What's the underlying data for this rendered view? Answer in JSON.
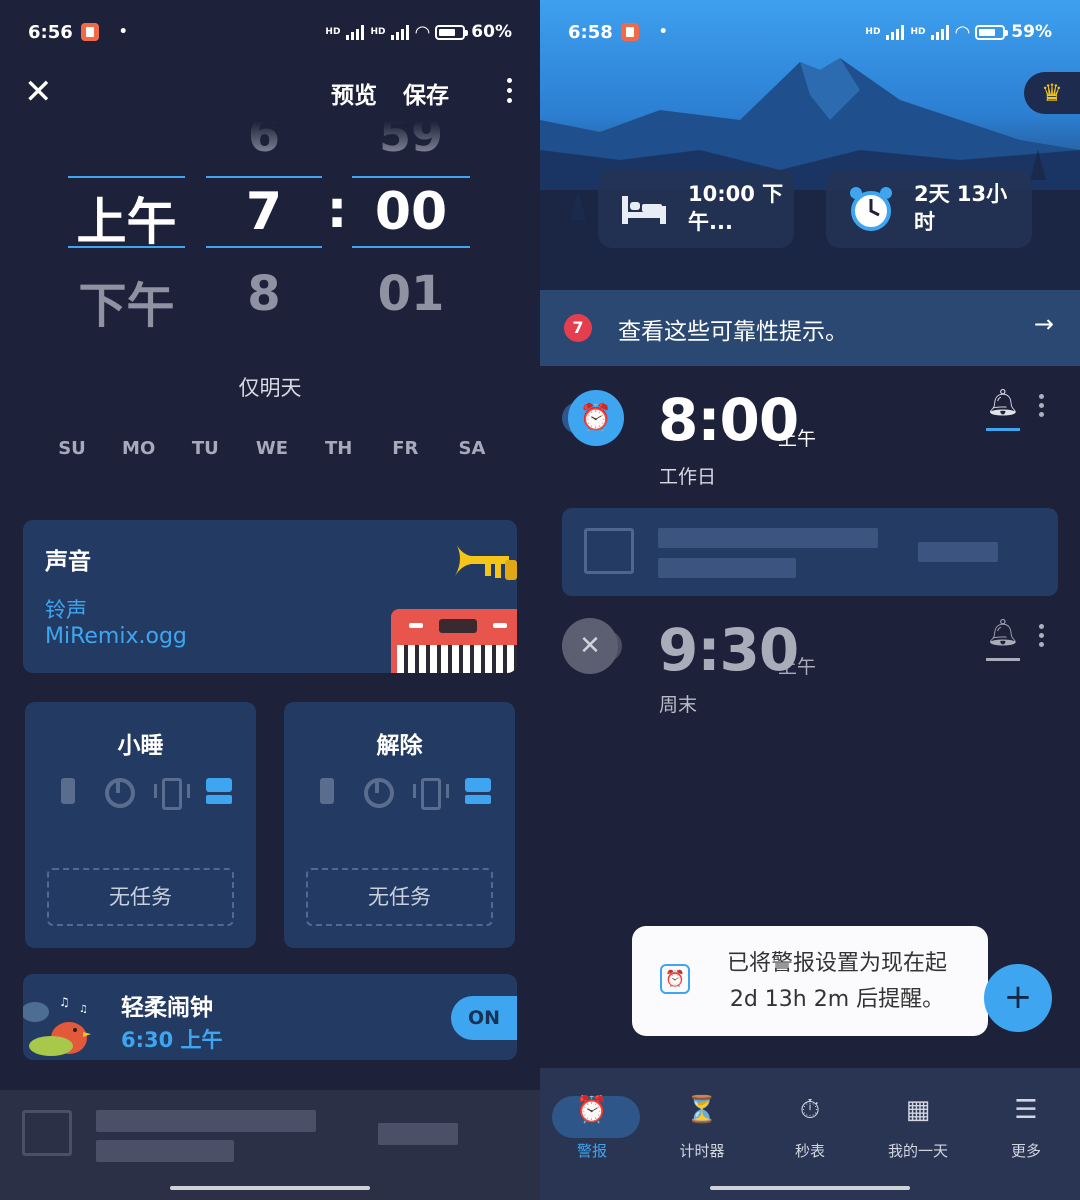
{
  "left": {
    "status": {
      "time": "6:56",
      "dot": "•",
      "hd1": "HD",
      "hd2": "HD",
      "battery_text": "60%",
      "battery_level": 60
    },
    "toolbar": {
      "preview": "预览",
      "save": "保存"
    },
    "picker": {
      "top_row": {
        "hour": "6",
        "minute": "59"
      },
      "selected": {
        "ampm": "上午",
        "hour": "7",
        "colon": ":",
        "minute": "00"
      },
      "bottom_row": {
        "ampm": "下午",
        "hour": "8",
        "minute": "01"
      }
    },
    "only_tomorrow": "仅明天",
    "days": [
      "SU",
      "MO",
      "TU",
      "WE",
      "TH",
      "FR",
      "SA"
    ],
    "sound": {
      "title": "声音",
      "subtitle": "铃声",
      "file": "MiRemix.ogg"
    },
    "snooze": {
      "title": "小睡",
      "task": "无任务"
    },
    "dismiss": {
      "title": "解除",
      "task": "无任务"
    },
    "gentle": {
      "title": "轻柔闹钟",
      "time": "6:30 上午",
      "toggle": "ON"
    }
  },
  "right": {
    "status": {
      "time": "6:58",
      "dot": "•",
      "hd1": "HD",
      "hd2": "HD",
      "battery_text": "59%",
      "battery_level": 59
    },
    "bedtime": {
      "line1": "10:00 下",
      "line2": "午..."
    },
    "next_alarm": {
      "line1": "2天 13小",
      "line2": "时"
    },
    "tips": {
      "count": "7",
      "text": "查看这些可靠性提示。",
      "arrow": "→"
    },
    "alarms": [
      {
        "time": "8:00",
        "ampm": "上午",
        "label": "工作日",
        "enabled": true
      },
      {
        "time": "9:30",
        "ampm": "上午",
        "label": "周末",
        "enabled": false
      }
    ],
    "toast": {
      "line1": "已将警报设置为现在起",
      "line2": "2d 13h 2m 后提醒。"
    },
    "fab": "+",
    "nav": [
      {
        "label": "警报",
        "icon": "alarm-icon",
        "active": true
      },
      {
        "label": "计时器",
        "icon": "hourglass-icon",
        "active": false
      },
      {
        "label": "秒表",
        "icon": "stopwatch-icon",
        "active": false
      },
      {
        "label": "我的一天",
        "icon": "calendar-icon",
        "active": false
      },
      {
        "label": "更多",
        "icon": "menu-icon",
        "active": false
      }
    ]
  },
  "colors": {
    "accent": "#3ea6f0",
    "background": "#1d2139",
    "card": "#233b63",
    "badge": "#e53e4f",
    "premium": "#f5c518"
  }
}
